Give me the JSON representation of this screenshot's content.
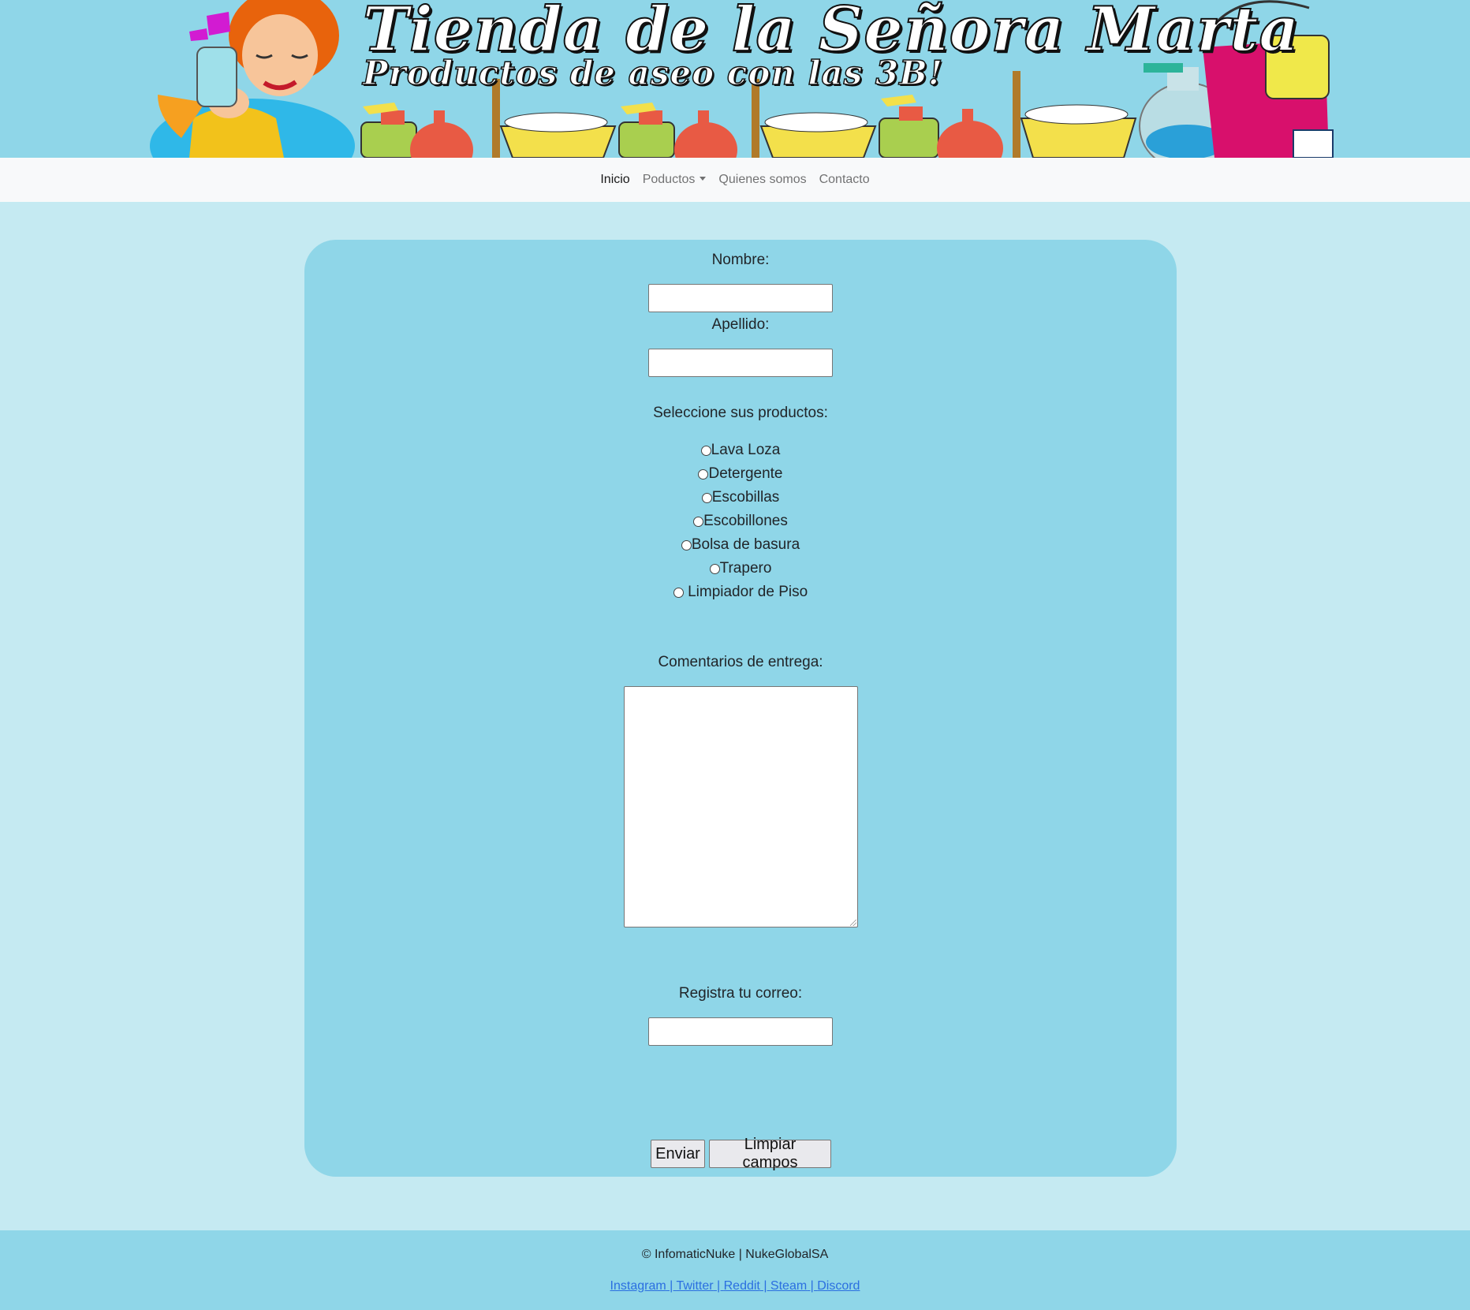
{
  "banner": {
    "title": "Tienda de la Señora Marta",
    "subtitle": "Productos de aseo con las 3B!"
  },
  "nav": {
    "items": [
      {
        "label": "Inicio",
        "active": true
      },
      {
        "label": "Poductos",
        "dropdown": true
      },
      {
        "label": "Quienes somos"
      },
      {
        "label": "Contacto"
      }
    ]
  },
  "form": {
    "nombre_label": "Nombre:",
    "nombre_value": "",
    "apellido_label": "Apellido:",
    "apellido_value": "",
    "productos_label": "Seleccione sus productos:",
    "productos": [
      {
        "label": "Lava Loza",
        "checked": false
      },
      {
        "label": "Detergente",
        "checked": false
      },
      {
        "label": "Escobillas",
        "checked": false
      },
      {
        "label": "Escobillones",
        "checked": false
      },
      {
        "label": "Bolsa de basura",
        "checked": false
      },
      {
        "label": "Trapero",
        "checked": false
      },
      {
        "label": " Limpiador de Piso",
        "checked": false
      }
    ],
    "comentarios_label": "Comentarios de entrega:",
    "comentarios_value": "",
    "correo_label": "Registra tu correo:",
    "correo_value": "",
    "submit_label": "Enviar",
    "reset_label": "Limpiar campos"
  },
  "footer": {
    "copyright": "© InfomaticNuke | NukeGlobalSA",
    "links": [
      "Instagram",
      "Twitter",
      "Reddit",
      "Steam",
      "Discord"
    ],
    "separator": " | "
  },
  "colors": {
    "page_bg": "#c5eaf2",
    "card_bg": "#8fd6e8",
    "navbar_bg": "#f8f9fa",
    "link": "#2b6fe0"
  }
}
